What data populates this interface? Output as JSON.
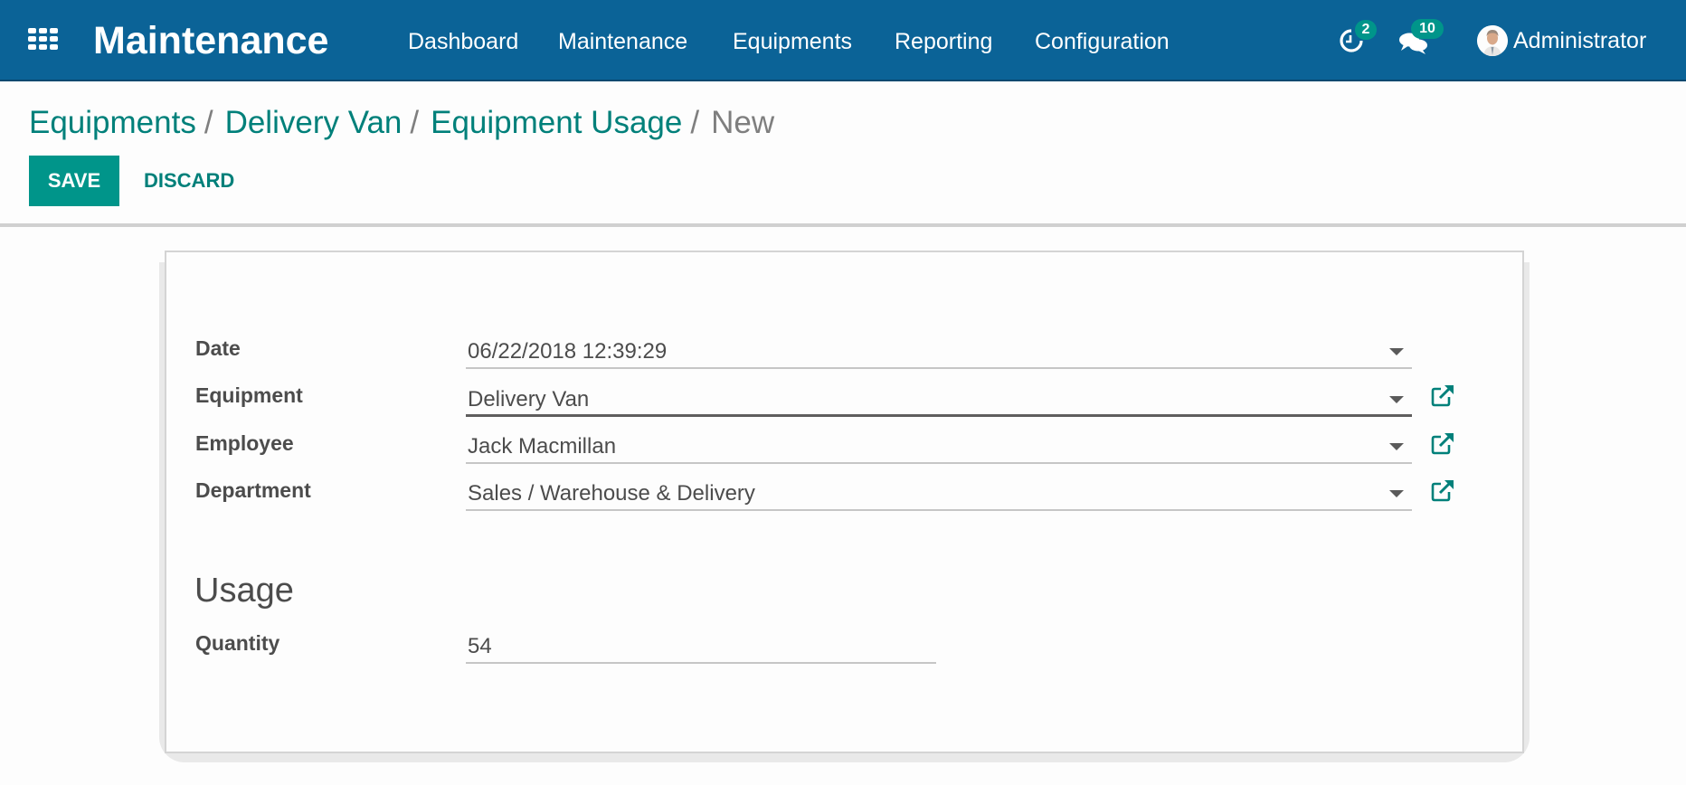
{
  "navbar": {
    "app_title": "Maintenance",
    "apps_icon": "grid-icon",
    "menu": [
      {
        "label": "Dashboard"
      },
      {
        "label": "Maintenance"
      },
      {
        "label": "Equipments"
      },
      {
        "label": "Reporting"
      },
      {
        "label": "Configuration"
      }
    ],
    "activities": {
      "icon": "clock-icon",
      "count": "2"
    },
    "messages": {
      "icon": "chat-bubbles-icon",
      "count": "10"
    },
    "user": {
      "name": "Administrator",
      "avatar": "user-avatar"
    }
  },
  "breadcrumb": {
    "items": [
      {
        "label": "Equipments"
      },
      {
        "label": "Delivery Van"
      },
      {
        "label": "Equipment Usage"
      }
    ],
    "separator": "/",
    "current": "New"
  },
  "toolbar": {
    "save_label": "SAVE",
    "discard_label": "DISCARD"
  },
  "form": {
    "fields": [
      {
        "label": "Date",
        "value": "06/22/2018 12:39:29"
      },
      {
        "label": "Equipment",
        "value": "Delivery Van"
      },
      {
        "label": "Employee",
        "value": "Jack Macmillan"
      },
      {
        "label": "Department",
        "value": "Sales / Warehouse & Delivery"
      }
    ],
    "usage_section": {
      "title": "Usage",
      "quantity_label": "Quantity",
      "quantity_value": "54"
    }
  },
  "colors": {
    "navbar": "#0b6397",
    "primary": "#00958a",
    "link": "#00807a",
    "badge": "#00958a",
    "text": "#4c4c4c"
  }
}
